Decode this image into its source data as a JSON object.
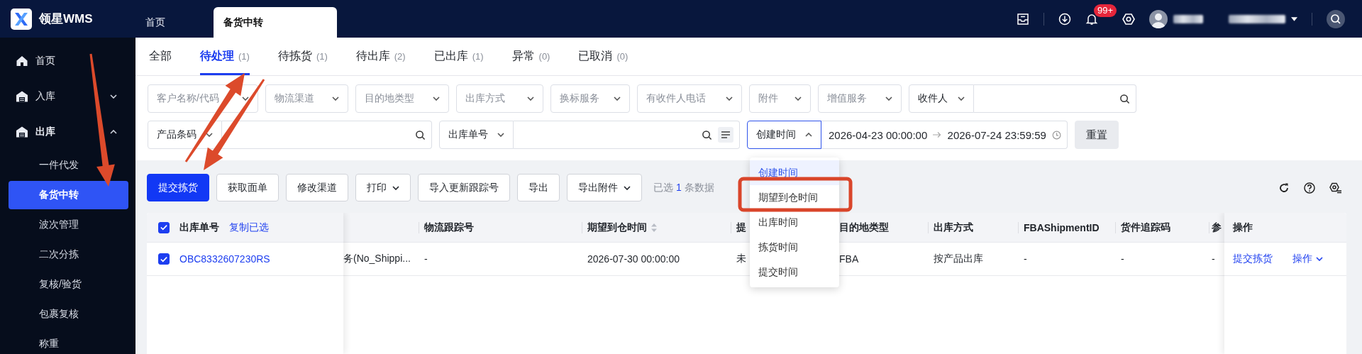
{
  "app": {
    "logo_text": "领星WMS"
  },
  "top_tabs": [
    {
      "label": "首页",
      "selected": false
    },
    {
      "label": "备货中转",
      "selected": true
    }
  ],
  "header": {
    "notification_count": "99+"
  },
  "sidebar": {
    "items": [
      {
        "label": "首页"
      },
      {
        "label": "入库",
        "expanded": false
      },
      {
        "label": "出库",
        "expanded": true,
        "children": [
          {
            "label": "一件代发",
            "selected": false
          },
          {
            "label": "备货中转",
            "selected": true
          },
          {
            "label": "波次管理",
            "selected": false
          },
          {
            "label": "二次分拣",
            "selected": false
          },
          {
            "label": "复核/验货",
            "selected": false
          },
          {
            "label": "包裹复核",
            "selected": false
          },
          {
            "label": "称重",
            "selected": false
          }
        ]
      }
    ]
  },
  "status_tabs": [
    {
      "label": "全部",
      "selected": false
    },
    {
      "label": "待处理",
      "count": "(1)",
      "selected": true
    },
    {
      "label": "待拣货",
      "count": "(1)",
      "selected": false
    },
    {
      "label": "待出库",
      "count": "(2)",
      "selected": false
    },
    {
      "label": "已出库",
      "count": "(1)",
      "selected": false
    },
    {
      "label": "异常",
      "count": "(0)",
      "selected": false
    },
    {
      "label": "已取消",
      "count": "(0)",
      "selected": false
    }
  ],
  "filters_top": [
    {
      "kind": "select",
      "placeholder": "客户名称/代码"
    },
    {
      "kind": "select",
      "placeholder": "物流渠道"
    },
    {
      "kind": "select",
      "placeholder": "目的地类型"
    },
    {
      "kind": "select",
      "placeholder": "出库方式"
    },
    {
      "kind": "select",
      "placeholder": "换标服务"
    },
    {
      "kind": "select",
      "placeholder": "有收件人电话"
    },
    {
      "kind": "select",
      "placeholder": "附件"
    },
    {
      "kind": "select",
      "placeholder": "增值服务"
    },
    {
      "kind": "search",
      "option": "收件人"
    }
  ],
  "filters_bottom": [
    {
      "kind": "search",
      "option": "产品条码"
    },
    {
      "kind": "batch_search",
      "option": "出库单号"
    },
    {
      "kind": "date_range",
      "option": "创建时间",
      "open": true,
      "start": "2026-04-23 00:00:00",
      "end": "2026-07-24 23:59:59",
      "options": [
        {
          "label": "创建时间",
          "selected": true
        },
        {
          "label": "期望到仓时间",
          "selected": false
        },
        {
          "label": "出库时间",
          "selected": false
        },
        {
          "label": "拣货时间",
          "selected": false
        },
        {
          "label": "提交时间",
          "selected": false
        }
      ]
    },
    {
      "kind": "button",
      "label": "重置"
    }
  ],
  "toolbar": {
    "buttons": [
      {
        "kind": "primary",
        "label": "提交拣货"
      },
      {
        "kind": "default",
        "label": "获取面单"
      },
      {
        "kind": "default",
        "label": "修改渠道"
      },
      {
        "kind": "menu",
        "label": "打印"
      },
      {
        "kind": "default",
        "label": "导入更新跟踪号"
      },
      {
        "kind": "default",
        "label": "导出"
      },
      {
        "kind": "menu",
        "label": "导出附件"
      }
    ],
    "selection": {
      "prefix": "已选",
      "count": "1",
      "suffix": "条数据"
    }
  },
  "table": {
    "all_checked": true,
    "order_column": "出库单号",
    "copy_action": "复制已选",
    "action_column": "操作",
    "columns": [
      {
        "kind": "blank"
      },
      {
        "kind": "text",
        "label": "物流跟踪号"
      },
      {
        "kind": "sortable",
        "label": "期望到仓时间"
      },
      {
        "kind": "text",
        "label": "提"
      },
      {
        "kind": "text",
        "label": "目的地类型"
      },
      {
        "kind": "text",
        "label": "出库方式"
      },
      {
        "kind": "text",
        "label": "FBAShipmentID"
      },
      {
        "kind": "text",
        "label": "货件追踪码"
      },
      {
        "kind": "text",
        "label": "参"
      }
    ],
    "rows": [
      {
        "checked": true,
        "order_no": "OBC8332607230RS",
        "cells": [
          "务(No_Shippi...",
          "-",
          "2026-07-30 00:00:00",
          "未",
          "FBA",
          "按产品出库",
          "-",
          "-",
          "-"
        ],
        "actions": [
          {
            "kind": "link",
            "label": "提交拣货"
          },
          {
            "kind": "menu",
            "label": "操作"
          }
        ]
      }
    ]
  },
  "annotations": [
    {
      "kind": "arrow"
    },
    {
      "kind": "arrow"
    },
    {
      "kind": "arrow"
    },
    {
      "kind": "frame"
    }
  ]
}
